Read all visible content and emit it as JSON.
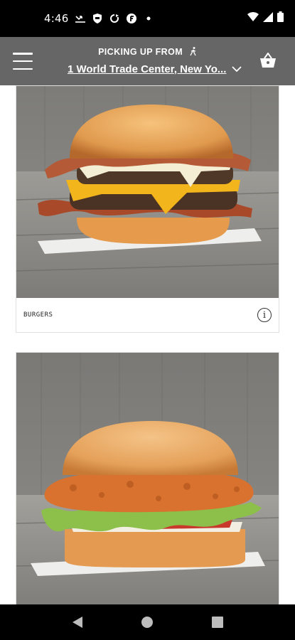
{
  "status_bar": {
    "time": "4:46",
    "notification_icons": [
      "missed-call-icon",
      "shield-icon",
      "sync-icon",
      "f-icon",
      "dot-icon"
    ],
    "system_icons": [
      "wifi-icon",
      "signal-icon",
      "battery-icon"
    ]
  },
  "header": {
    "pickup_label": "PICKING UP FROM",
    "location": "1 World Trade Center, New Yo...",
    "icons": [
      "menu-icon",
      "walking-icon",
      "chevron-down-icon",
      "basket-icon"
    ]
  },
  "menu_cards": [
    {
      "category": "BURGERS",
      "image": "bacon-cheeseburger-photo"
    },
    {
      "category": "",
      "image": "crispy-chicken-sandwich-photo"
    }
  ],
  "nav_bar": {
    "icons": [
      "back-icon",
      "home-icon",
      "recents-icon"
    ]
  },
  "colors": {
    "header_bg": "#666666",
    "status_bg": "#000000",
    "wood": "#8e8e8c",
    "bun": "#e3a055"
  }
}
